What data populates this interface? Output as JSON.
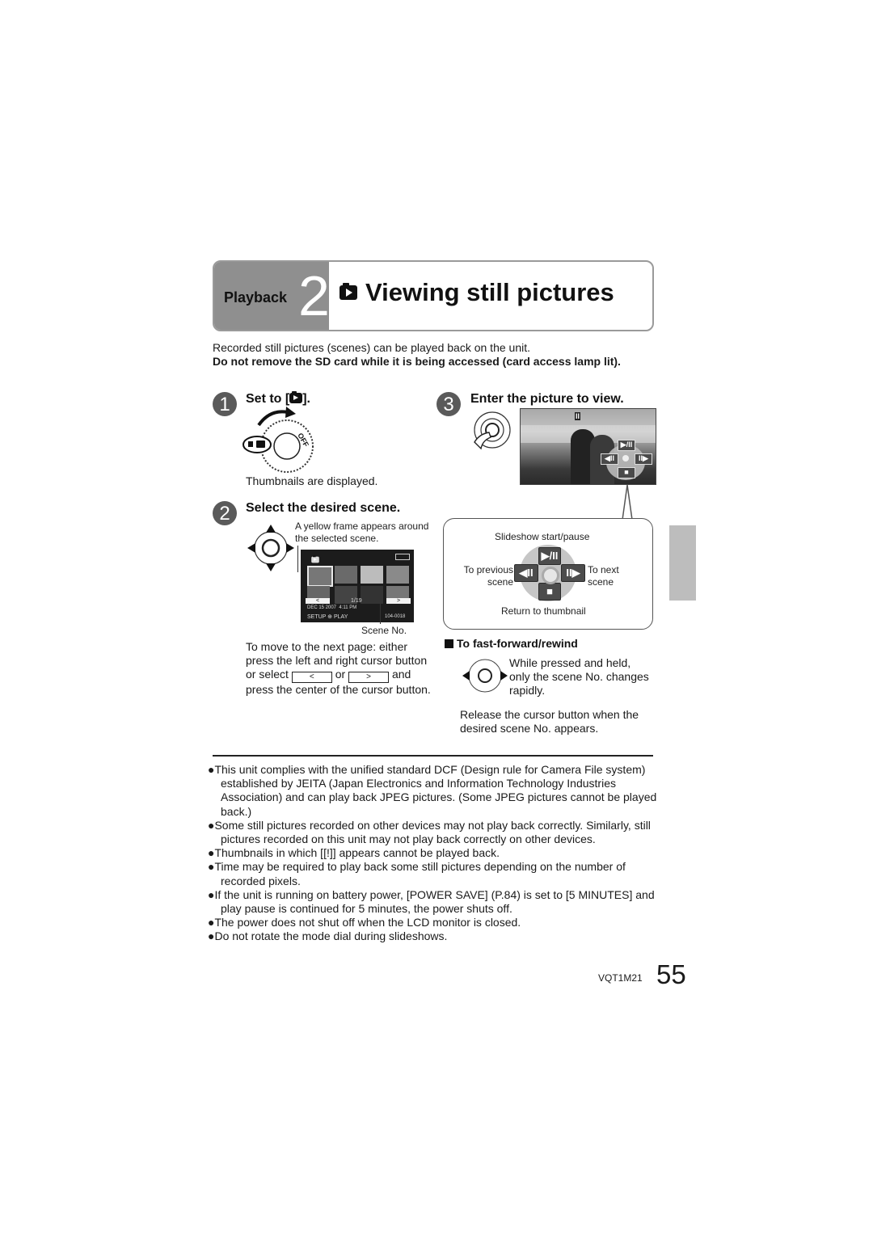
{
  "header": {
    "section_label": "Playback",
    "section_number": "2",
    "title_icon": "still-picture-playback-icon",
    "title": "Viewing still pictures"
  },
  "intro": {
    "line1": "Recorded still pictures (scenes) can be played back on the unit.",
    "warning": "Do not remove the SD card while it is being accessed (card access lamp lit)."
  },
  "step1": {
    "number": "1",
    "title_prefix": "Set to [",
    "title_suffix": "].",
    "dial_labels": [
      "OFF"
    ],
    "note": "Thumbnails are displayed."
  },
  "step2": {
    "number": "2",
    "title": "Select the desired scene.",
    "annotation_frame": "A yellow frame appears around the selected scene.",
    "annotation_scene": "Scene No.",
    "screen": {
      "page_prev": "<",
      "page_next": ">",
      "page_count": "1/19",
      "date": "DEC 15 2007",
      "time": "4:11 PM",
      "setup_label": "SETUP",
      "play_label": "PLAY",
      "scene_number": "104-0018"
    },
    "next_page_text_1": "To move to the next page: either press the left and right cursor button or select",
    "next_page_btn_prev": "<",
    "next_page_or": "or",
    "next_page_btn_next": ">",
    "next_page_text_2": "and press the center of the cursor button."
  },
  "step3": {
    "number": "3",
    "title": "Enter the picture to view.",
    "screen": {
      "pause_icon": "II",
      "play_pause": "▶/II",
      "prev": "◀II",
      "next": "II▶",
      "stop": "■"
    },
    "callout": {
      "slideshow": "Slideshow start/pause",
      "prev_label": "To previous scene",
      "next_label": "To next scene",
      "return_label": "Return to thumbnail",
      "play_pause": "▶/II",
      "prev": "◀II",
      "next": "II▶",
      "stop": "■"
    },
    "ff": {
      "heading": "To fast-forward/rewind",
      "text": "While pressed and held, only the scene No. changes rapidly.",
      "release": "Release the cursor button when the desired scene No. appears."
    }
  },
  "notes": [
    "●This unit complies with the unified standard DCF (Design rule for Camera File system) established by JEITA (Japan Electronics and Information Technology Industries Association) and can play back JPEG pictures. (Some JPEG pictures cannot be played back.)",
    "●Some still pictures recorded on other devices may not play back correctly. Similarly, still pictures recorded on this unit may not play back correctly on other devices.",
    "●Thumbnails in which [[!]] appears cannot be played back.",
    "●Time may be required to play back some still pictures depending on the number of recorded pixels.",
    "●If the unit is running on battery power, [POWER SAVE] (P.84) is set to [5 MINUTES] and play pause is continued for 5 minutes, the power shuts off.",
    "●The power does not shut off when the LCD monitor is closed.",
    "●Do not rotate the mode dial during slideshows."
  ],
  "footer": {
    "model_code": "VQT1M21",
    "page_number": "55"
  }
}
